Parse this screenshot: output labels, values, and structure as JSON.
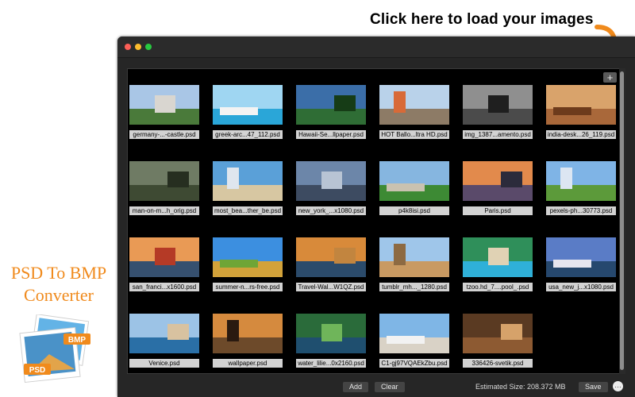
{
  "callout": {
    "text": "Click here to load your images",
    "arrow_color": "#f08a1c"
  },
  "promo": {
    "line1": "PSD To BMP",
    "line2": "Converter",
    "icon_label_top": "BMP",
    "icon_label_bottom": "PSD",
    "color": "#f08a1c"
  },
  "toolbar": {
    "add_icon_glyph": "+"
  },
  "images": [
    {
      "label": "germany-...-castle.psd",
      "sky": "#a9c6e6",
      "ground": "#4a7a3a",
      "shape": "#d9d6d0"
    },
    {
      "label": "greek-arc...47_112.psd",
      "sky": "#9fd6f2",
      "ground": "#2aa6d8",
      "shape": "#f3f3f3"
    },
    {
      "label": "Hawaii-Se...llpaper.psd",
      "sky": "#3b6ea8",
      "ground": "#2f6d35",
      "shape": "#163c16"
    },
    {
      "label": "HOT Ballo...ltra HD.psd",
      "sky": "#b9d2ea",
      "ground": "#8d7b66",
      "shape": "#d86a38"
    },
    {
      "label": "img_1387...amento.psd",
      "sky": "#8f8f8f",
      "ground": "#4b4b4b",
      "shape": "#1f1f1f"
    },
    {
      "label": "india-desk...26_119.psd",
      "sky": "#d9a36b",
      "ground": "#a9683a",
      "shape": "#6d3b1c"
    },
    {
      "label": "man-on-m...h_orig.psd",
      "sky": "#6f7b64",
      "ground": "#3e4a33",
      "shape": "#262e20"
    },
    {
      "label": "most_bea...ther_be.psd",
      "sky": "#5aa0d8",
      "ground": "#d7c7a2",
      "shape": "#dfe6ee"
    },
    {
      "label": "new_york_...x1080.psd",
      "sky": "#6c86a9",
      "ground": "#3d4b61",
      "shape": "#b8c4d4"
    },
    {
      "label": "p4k8isi.psd",
      "sky": "#86b6e0",
      "ground": "#3d8a34",
      "shape": "#c9c2b0"
    },
    {
      "label": "Paris.psd",
      "sky": "#e28a4c",
      "ground": "#5a4a6a",
      "shape": "#2b2b3b"
    },
    {
      "label": "pexels-ph...30773.psd",
      "sky": "#7fb4e6",
      "ground": "#5c9a3a",
      "shape": "#dce6f2"
    },
    {
      "label": "san_franci...x1600.psd",
      "sky": "#e99a55",
      "ground": "#36506f",
      "shape": "#b53a26"
    },
    {
      "label": "summer-n...rs-free.psd",
      "sky": "#3c8fe0",
      "ground": "#d2a23a",
      "shape": "#6fa536"
    },
    {
      "label": "Travel-Wal...W1QZ.psd",
      "sky": "#d88a3a",
      "ground": "#2b4b6b",
      "shape": "#c2853f"
    },
    {
      "label": "tumblr_mh..._1280.psd",
      "sky": "#9fc6ea",
      "ground": "#c99a62",
      "shape": "#8d6a42"
    },
    {
      "label": "tzoo.hd_7....pool_.psd",
      "sky": "#2f8f5a",
      "ground": "#2fb0d8",
      "shape": "#e0d2b4"
    },
    {
      "label": "usa_new_j...x1080.psd",
      "sky": "#5a7cc6",
      "ground": "#26486e",
      "shape": "#e6e6f0"
    },
    {
      "label": "Venice.psd",
      "sky": "#9cc3e6",
      "ground": "#2a6fa6",
      "shape": "#d8c2a0"
    },
    {
      "label": "wallpaper.psd",
      "sky": "#d58a3e",
      "ground": "#6d4a2a",
      "shape": "#2a1a10"
    },
    {
      "label": "water_lilie...0x2160.psd",
      "sky": "#2a6b3a",
      "ground": "#1f4f6f",
      "shape": "#6fb55a"
    },
    {
      "label": "C1-gj97VQAEkZbu.psd",
      "sky": "#7fb6e6",
      "ground": "#d9d2c6",
      "shape": "#f2f2f2"
    },
    {
      "label": "336426-svetik.psd",
      "sky": "#5a3a22",
      "ground": "#8d5a32",
      "shape": "#d6a26a"
    }
  ],
  "footer": {
    "add_label": "Add",
    "clear_label": "Clear",
    "estimated_size": "Estimated Size: 208.372 MB",
    "save_label": "Save",
    "more_glyph": "…"
  }
}
